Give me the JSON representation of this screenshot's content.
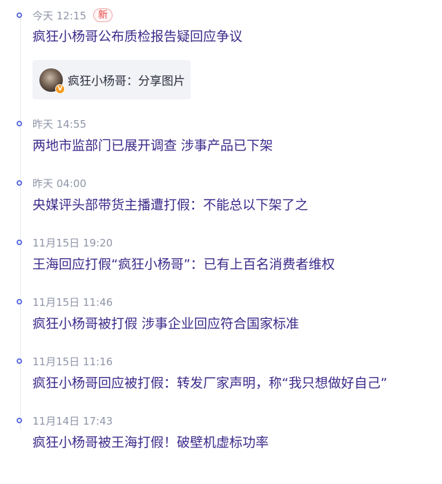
{
  "timeline": {
    "badge_new": "新",
    "share_card": {
      "author": "疯狂小杨哥",
      "separator": "：",
      "action": "分享图片",
      "verified_mark": "V"
    },
    "entries": [
      {
        "time": "今天 12:15",
        "headline": "疯狂小杨哥公布质检报告疑回应争议"
      },
      {
        "time": "昨天 14:55",
        "headline": "两地市监部门已展开调查 涉事产品已下架"
      },
      {
        "time": "昨天 04:00",
        "headline": "央媒评头部带货主播遭打假：不能总以下架了之"
      },
      {
        "time": "11月15日 19:20",
        "headline": "王海回应打假“疯狂小杨哥”：已有上百名消费者维权"
      },
      {
        "time": "11月15日 11:46",
        "headline": "疯狂小杨哥被打假 涉事企业回应符合国家标准"
      },
      {
        "time": "11月15日 11:16",
        "headline": "疯狂小杨哥回应被打假：转发厂家声明，称“我只想做好自己”"
      },
      {
        "time": "11月14日 17:43",
        "headline": "疯狂小杨哥被王海打假！破壁机虚标功率"
      }
    ]
  }
}
